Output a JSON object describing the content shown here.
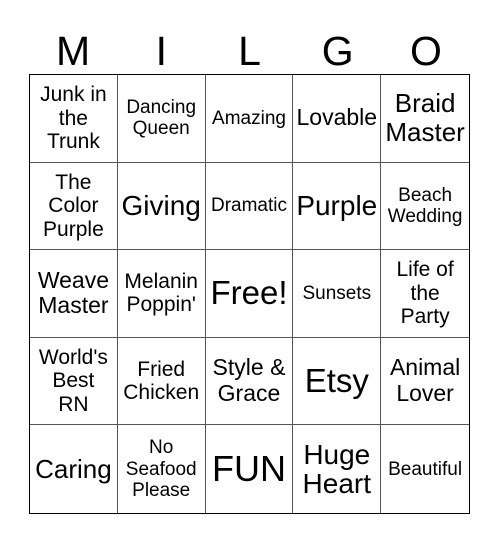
{
  "header": {
    "letters": [
      "M",
      "I",
      "L",
      "G",
      "O"
    ]
  },
  "cells": [
    [
      "Junk in\nthe\nTrunk",
      "Dancing\nQueen",
      "Amazing",
      "Lovable",
      "Braid\nMaster"
    ],
    [
      "The\nColor\nPurple",
      "Giving",
      "Dramatic",
      "Purple",
      "Beach\nWedding"
    ],
    [
      "Weave\nMaster",
      "Melanin\nPoppin'",
      "Free!",
      "Sunsets",
      "Life of\nthe\nParty"
    ],
    [
      "World's\nBest\nRN",
      "Fried\nChicken",
      "Style &\nGrace",
      "Etsy",
      "Animal\nLover"
    ],
    [
      "Caring",
      "No\nSeafood\nPlease",
      "FUN",
      "Huge\nHeart",
      "Beautiful"
    ]
  ]
}
